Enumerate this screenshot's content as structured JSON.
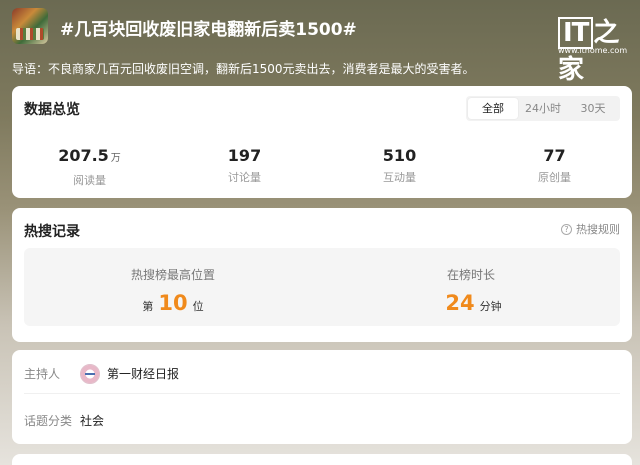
{
  "header": {
    "topic_title": "#几百块回收废旧家电翻新后卖1500#",
    "intro": "导语：不良商家几百元回收废旧空调，翻新后1500元卖出去，消费者是最大的受害者。",
    "watermark": {
      "mark": "IT",
      "mark_cn": "之家",
      "url": "www.ithome.com"
    }
  },
  "stats": {
    "heading": "数据总览",
    "tabs": [
      {
        "label": "全部",
        "active": true
      },
      {
        "label": "24小时",
        "active": false
      },
      {
        "label": "30天",
        "active": false
      }
    ],
    "items": [
      {
        "value": "207.5",
        "unit": "万",
        "label": "阅读量"
      },
      {
        "value": "197",
        "unit": "",
        "label": "讨论量"
      },
      {
        "value": "510",
        "unit": "",
        "label": "互动量"
      },
      {
        "value": "77",
        "unit": "",
        "label": "原创量"
      }
    ]
  },
  "hot": {
    "heading": "热搜记录",
    "rules_label": "热搜规则",
    "rules_icon": "question-icon",
    "peak": {
      "label": "热搜榜最高位置",
      "prefix": "第",
      "value": "10",
      "suffix": "位"
    },
    "duration": {
      "label": "在榜时长",
      "value": "24",
      "suffix": "分钟"
    },
    "accent": "#f08a1c"
  },
  "info": {
    "host_label": "主持人",
    "host_name": "第一财经日报",
    "category_label": "话题分类",
    "category_value": "社会"
  }
}
